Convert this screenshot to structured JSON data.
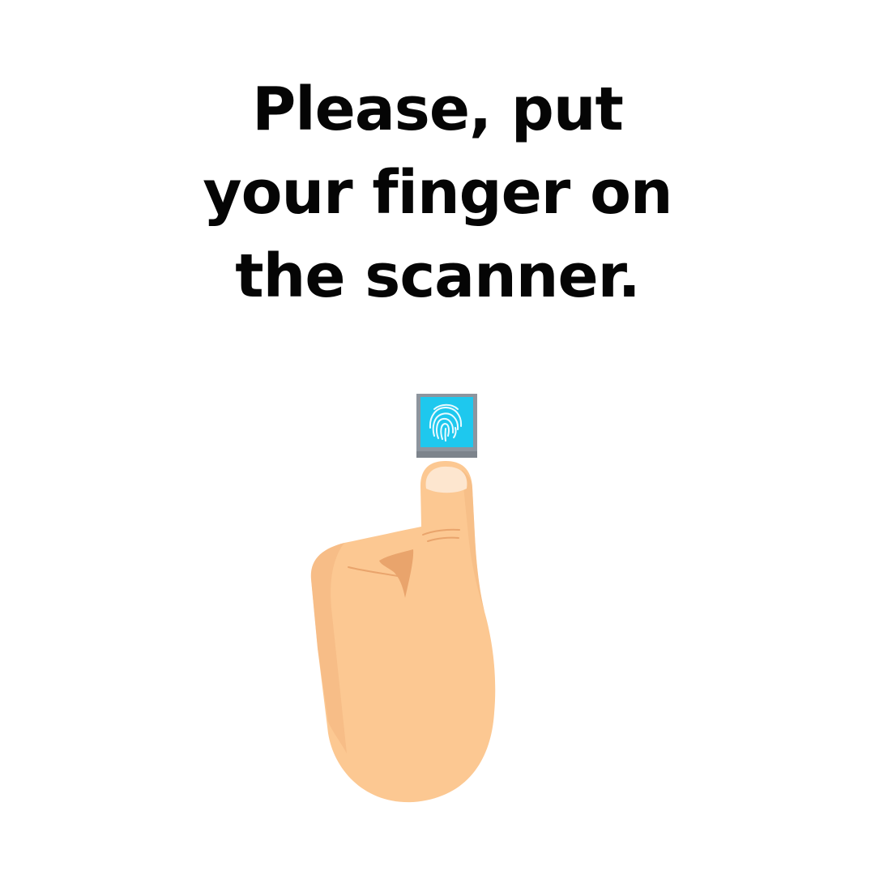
{
  "instruction": {
    "lines": [
      "Please, put",
      "your finger on",
      "the scanner."
    ]
  },
  "scanner": {
    "icon": "fingerprint-icon",
    "frame_color": "#8d959e",
    "pad_color": "#1ec8ee",
    "ridge_color": "#eafaff"
  },
  "hand": {
    "icon": "pointing-hand-icon",
    "skin_color": "#fcc892",
    "shade_color": "#e9a46c",
    "nail_color": "#fde6cf"
  }
}
